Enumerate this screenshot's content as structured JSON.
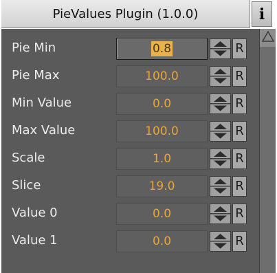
{
  "header": {
    "title": "PieValues Plugin (1.0.0)",
    "info_glyph": "i"
  },
  "rows": [
    {
      "label": "Pie Min",
      "value": "0.8",
      "reset": "R",
      "active": true
    },
    {
      "label": "Pie Max",
      "value": "100.0",
      "reset": "R"
    },
    {
      "label": "Min Value",
      "value": "0.0",
      "reset": "R"
    },
    {
      "label": "Max Value",
      "value": "100.0",
      "reset": "R"
    },
    {
      "label": "Scale",
      "value": "1.0",
      "reset": "R"
    },
    {
      "label": "Slice",
      "value": "19.0",
      "reset": "R"
    },
    {
      "label": "Value 0",
      "value": "0.0",
      "reset": "R"
    },
    {
      "label": "Value 1",
      "value": "0.0",
      "reset": "R"
    }
  ],
  "icons": {
    "stepper": "up-down-stepper-icon",
    "scroll_up": "scroll-up-arrow-icon",
    "info": "info-icon"
  },
  "colors": {
    "panel_bg": "#5a5a5a",
    "value_text": "#e7a53f",
    "label_text": "#ececec",
    "selection": "#e9b24a"
  }
}
